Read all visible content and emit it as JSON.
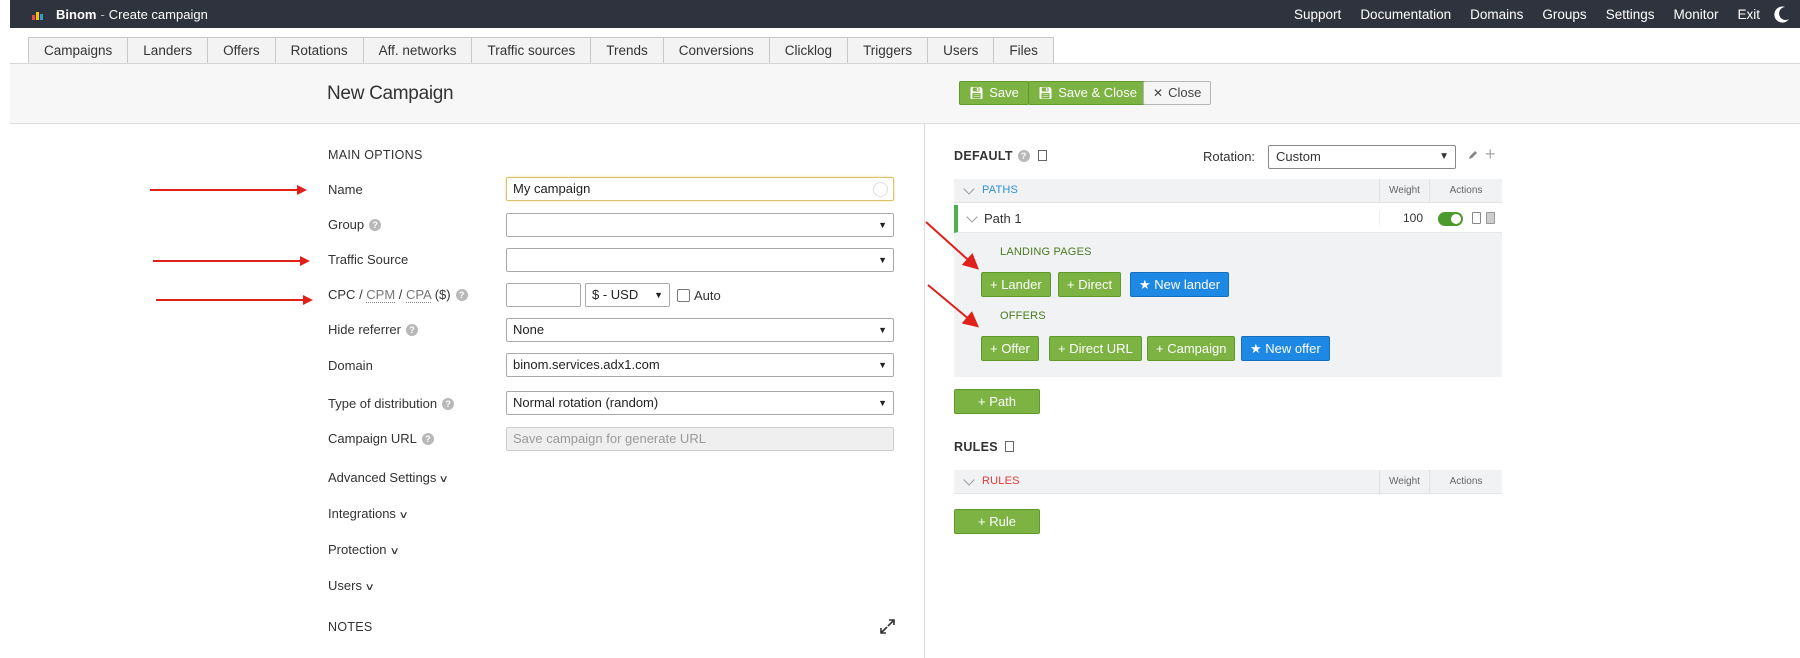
{
  "topbar": {
    "app_name": "Binom",
    "page_name": "Create campaign",
    "nav": [
      "Support",
      "Documentation",
      "Domains",
      "Groups",
      "Settings",
      "Monitor",
      "Exit"
    ]
  },
  "tabs": [
    "Campaigns",
    "Landers",
    "Offers",
    "Rotations",
    "Aff. networks",
    "Traffic sources",
    "Trends",
    "Conversions",
    "Clicklog",
    "Triggers",
    "Users",
    "Files"
  ],
  "header": {
    "title": "New Campaign",
    "save": "Save",
    "save_close": "Save & Close",
    "close": "Close"
  },
  "main_options": {
    "title": "MAIN OPTIONS",
    "name_label": "Name",
    "name_value": "My campaign",
    "group_label": "Group",
    "group_value": "",
    "traffic_source_label": "Traffic Source",
    "traffic_source_value": "",
    "cost_label_cpc": "CPC",
    "cost_label_slash1": " / ",
    "cost_label_cpm": "CPM",
    "cost_label_slash2": " / ",
    "cost_label_cpa": "CPA",
    "cost_label_currency": " ($)",
    "cost_value": "",
    "currency_value": "$ - USD",
    "auto_label": "Auto",
    "hide_referrer_label": "Hide referrer",
    "hide_referrer_value": "None",
    "domain_label": "Domain",
    "domain_value": "binom.services.adx1.com",
    "distribution_label": "Type of distribution",
    "distribution_value": "Normal rotation (random)",
    "campaign_url_label": "Campaign URL",
    "campaign_url_placeholder": "Save campaign for generate URL"
  },
  "collapsibles": [
    "Advanced Settings",
    "Integrations",
    "Protection",
    "Users"
  ],
  "notes_title": "NOTES",
  "right": {
    "default_title": "DEFAULT",
    "rotation_label": "Rotation:",
    "rotation_value": "Custom",
    "paths_header": "PATHS",
    "weight_header": "Weight",
    "actions_header": "Actions",
    "path_name": "Path 1",
    "path_weight": "100",
    "landing_pages_title": "LANDING PAGES",
    "lander_btn": "+ Lander",
    "direct_btn": "+ Direct",
    "new_lander_btn": "★ New lander",
    "offers_title": "OFFERS",
    "offer_btn": "+ Offer",
    "direct_url_btn": "+ Direct URL",
    "campaign_btn": "+ Campaign",
    "new_offer_btn": "★ New offer",
    "add_path_btn": "+ Path",
    "rules_title": "RULES",
    "rules_header": "RULES",
    "add_rule_btn": "+ Rule"
  },
  "colors": {
    "topbar": "#2f333e",
    "green": "#7cb342",
    "blue": "#1e88e5",
    "annotation_red": "#e0201b",
    "rules_red": "#e53935",
    "paths_blue": "#2f8fd8"
  }
}
